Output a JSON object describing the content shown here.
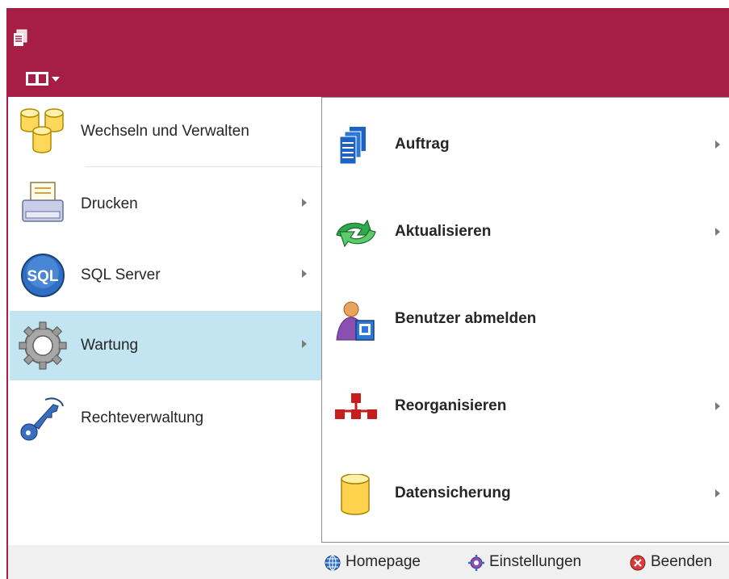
{
  "titlebar": {
    "color": "#a61d45",
    "app_icon": "document-stack-icon",
    "menu_icon": "panel-dropdown-icon"
  },
  "left_menu": {
    "items": [
      {
        "label": "Wechseln und Verwalten",
        "icon": "database-cylinders-icon",
        "has_submenu": false
      },
      {
        "label": "Drucken",
        "icon": "printer-icon",
        "has_submenu": true
      },
      {
        "label": "SQL Server",
        "icon": "sql-icon",
        "has_submenu": true,
        "icon_text": "SQL"
      },
      {
        "label": "Wartung",
        "icon": "gear-icon",
        "has_submenu": true,
        "active": true
      },
      {
        "label": "Rechteverwaltung",
        "icon": "key-icon",
        "has_submenu": false
      }
    ],
    "active_color": "#c3e4f1"
  },
  "submenu": {
    "items": [
      {
        "label": "Auftrag",
        "icon": "documents-icon",
        "has_submenu": true
      },
      {
        "label": "Aktualisieren",
        "icon": "refresh-arrows-icon",
        "has_submenu": true
      },
      {
        "label": "Benutzer abmelden",
        "icon": "user-logoff-icon",
        "has_submenu": false
      },
      {
        "label": "Reorganisieren",
        "icon": "hierarchy-icon",
        "has_submenu": true
      },
      {
        "label": "Datensicherung",
        "icon": "database-icon",
        "has_submenu": true
      }
    ]
  },
  "bottom_bar": {
    "homepage": "Homepage",
    "settings": "Einstellungen",
    "exit": "Beenden"
  }
}
